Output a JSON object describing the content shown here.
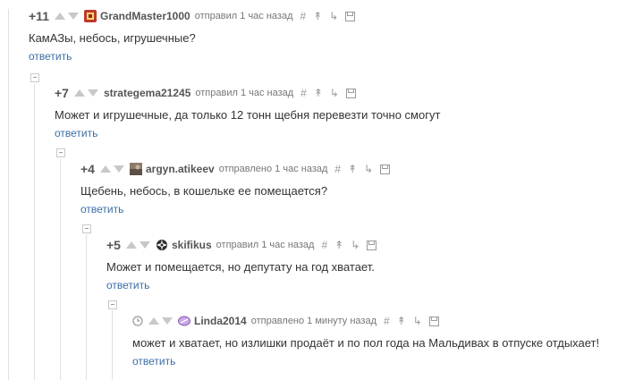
{
  "comments": [
    {
      "rating": "+11",
      "nick": "GrandMaster1000",
      "meta": "отправил 1 час назад",
      "text": "КамАЗы, небось, игрушечные?",
      "reply": "ответить",
      "avatar": "red-badge-avatar"
    },
    {
      "rating": "+7",
      "nick": "strategema21245",
      "meta": "отправил 1 час назад",
      "text": "Может и игрушечные, да только 12 тонн щебня перевезти точно смогут",
      "reply": "ответить",
      "avatar": ""
    },
    {
      "rating": "+4",
      "nick": "argyn.atikeev",
      "meta": "отправлено 1 час назад",
      "text": "Щебень, небось, в кошельке ее помещается?",
      "reply": "ответить",
      "avatar": "photo-avatar"
    },
    {
      "rating": "+5",
      "nick": "skifikus",
      "meta": "отправил 1 час назад",
      "text": "Может и помещается, но депутату на год хватает.",
      "reply": "ответить",
      "avatar": "emblem-avatar"
    },
    {
      "rating": "",
      "nick": "Linda2014",
      "meta": "отправлено 1 минуту назад",
      "text": "может и хватает, но излишки продаёт и по пол года на Мальдивах в отпуске отдыхает!",
      "reply": "ответить",
      "avatar": "purple-badge-avatar"
    }
  ],
  "toolbar_icons": [
    "hash-icon",
    "pin-icon",
    "branch-icon",
    "save-icon"
  ],
  "colors": {
    "link": "#3a6ea5",
    "text": "#333333",
    "meta": "#777777",
    "vote_arrow": "#c8c8c8"
  }
}
